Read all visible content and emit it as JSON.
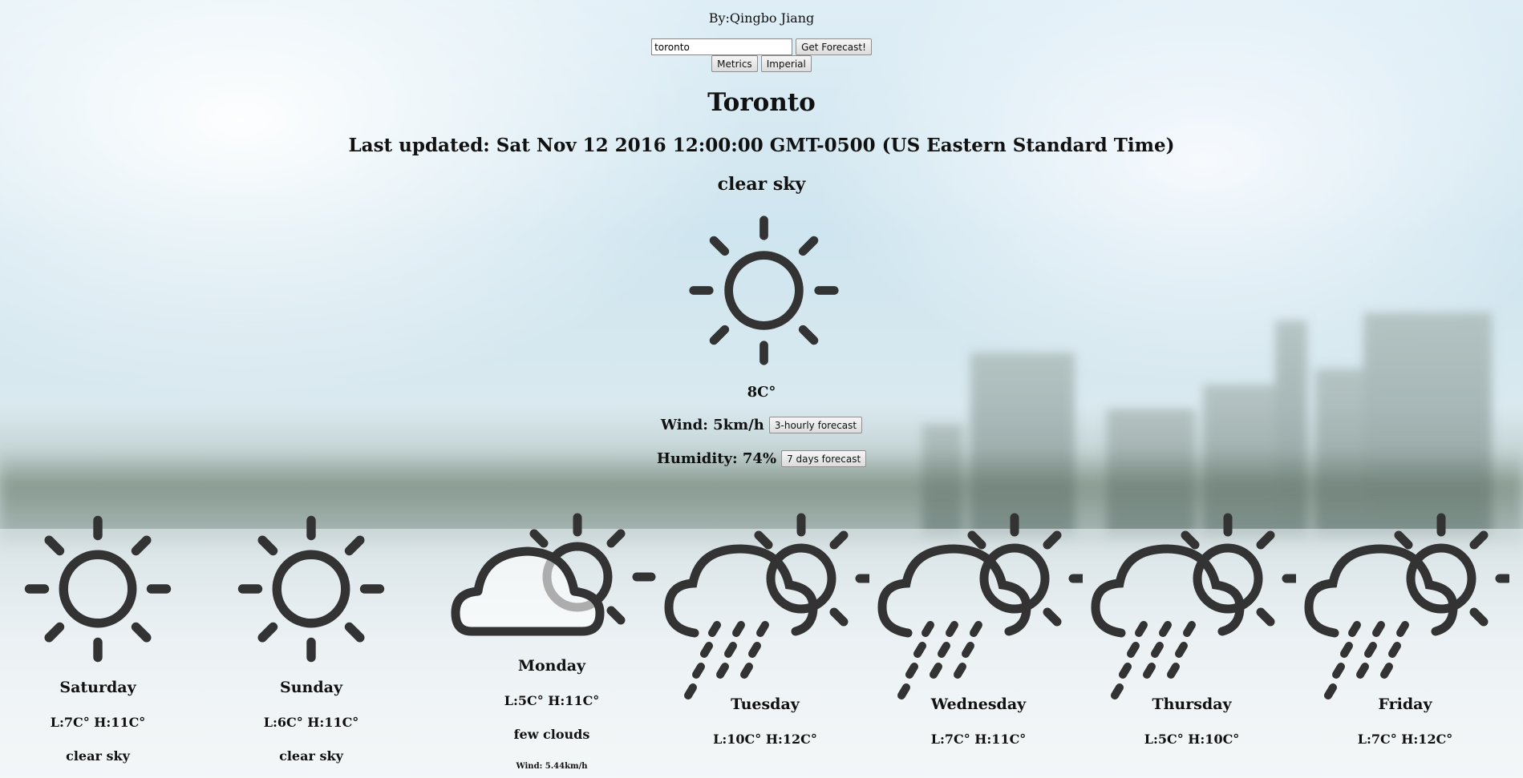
{
  "header": {
    "byline": "By:Qingbo Jiang"
  },
  "search": {
    "value": "toronto",
    "button_label": "Get Forecast!"
  },
  "units": {
    "metric_label": "Metrics",
    "imperial_label": "Imperial"
  },
  "current": {
    "city": "Toronto",
    "last_updated": "Last updated: Sat Nov 12 2016 12:00:00 GMT-0500 (US Eastern Standard Time)",
    "description": "clear sky",
    "icon": "sun-icon",
    "temperature": "8C°",
    "wind": "Wind: 5km/h",
    "humidity": "Humidity: 74%",
    "hourly_button_label": "3-hourly forecast",
    "daily_button_label": "7 days forecast"
  },
  "forecast": [
    {
      "day": "Saturday",
      "range": "L:7C° H:11C°",
      "description": "clear sky",
      "icon": "sun-icon"
    },
    {
      "day": "Sunday",
      "range": "L:6C° H:11C°",
      "description": "clear sky",
      "icon": "sun-icon"
    },
    {
      "day": "Monday",
      "range": "L:5C° H:11C°",
      "description": "few clouds",
      "wind": "Wind: 5.44km/h",
      "icon": "cloud-sun-icon"
    },
    {
      "day": "Tuesday",
      "range": "L:10C° H:12C°",
      "icon": "rain-cloud-sun-icon"
    },
    {
      "day": "Wednesday",
      "range": "L:7C° H:11C°",
      "icon": "rain-cloud-sun-icon"
    },
    {
      "day": "Thursday",
      "range": "L:5C° H:10C°",
      "icon": "rain-cloud-sun-icon"
    },
    {
      "day": "Friday",
      "range": "L:7C° H:12C°",
      "icon": "rain-cloud-sun-icon"
    }
  ],
  "colors": {
    "icon": "#333333",
    "text": "#111111"
  }
}
